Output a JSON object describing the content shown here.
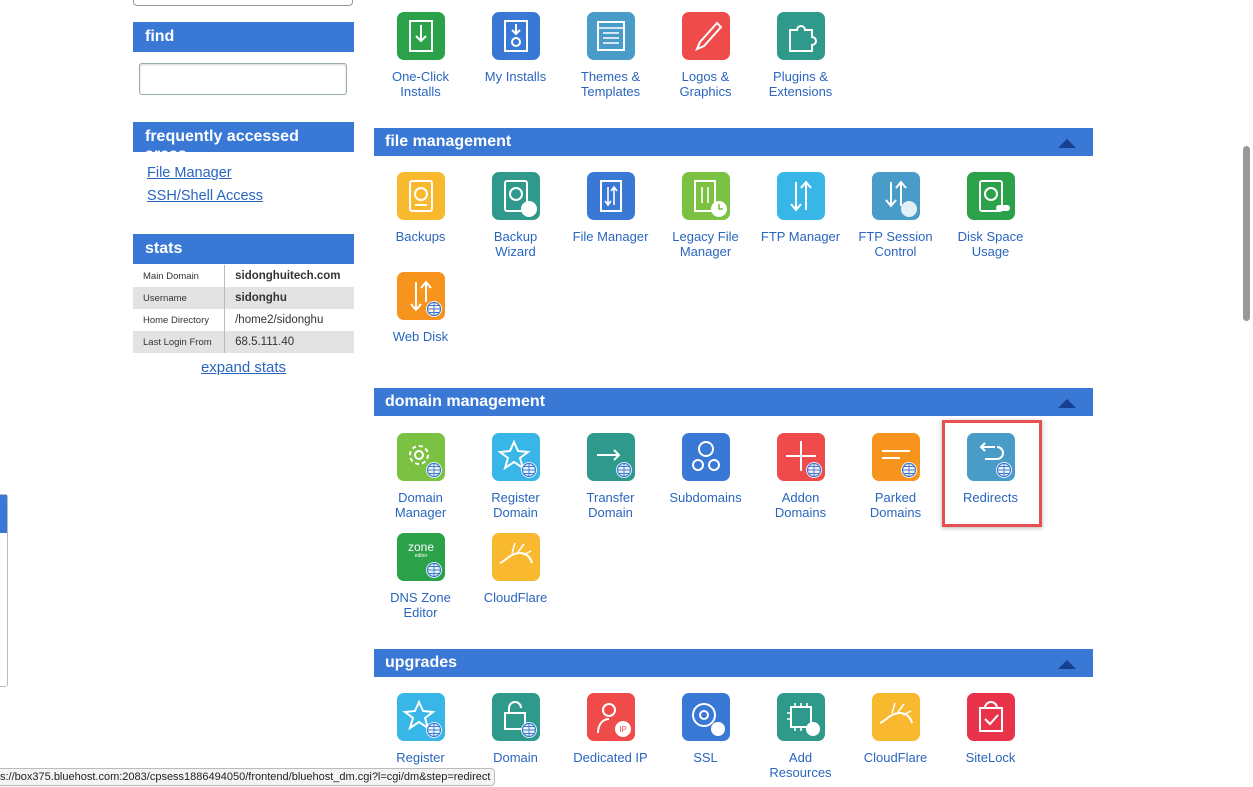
{
  "sidebar": {
    "find": {
      "title": "find",
      "value": ""
    },
    "frequent": {
      "title": "frequently accessed areas",
      "links": [
        "File Manager",
        "SSH/Shell Access"
      ]
    },
    "stats": {
      "title": "stats",
      "rows": [
        {
          "label": "Main Domain",
          "value": "sidonghuitech.com"
        },
        {
          "label": "Username",
          "value": "sidonghu"
        },
        {
          "label": "Home Directory",
          "value": "/home2/sidonghu"
        },
        {
          "label": "Last Login From",
          "value": "68.5.111.40"
        }
      ],
      "expand": "expand stats"
    }
  },
  "sections": {
    "top": {
      "items": [
        {
          "label": "One-Click\nInstalls",
          "color": "#2ba14a",
          "icon": "one-click-installs-icon"
        },
        {
          "label": "My Installs",
          "color": "#3a78d6",
          "icon": "my-installs-icon"
        },
        {
          "label": "Themes &\nTemplates",
          "color": "#4a9cc8",
          "icon": "themes-icon"
        },
        {
          "label": "Logos &\nGraphics",
          "color": "#ef4b4b",
          "icon": "paintbrush-icon"
        },
        {
          "label": "Plugins &\nExtensions",
          "color": "#2f9a8c",
          "icon": "puzzle-icon"
        }
      ]
    },
    "file": {
      "title": "file management",
      "items": [
        {
          "label": "Backups",
          "color": "#f9b92f",
          "icon": "backups-icon"
        },
        {
          "label": "Backup\nWizard",
          "color": "#2f9a8c",
          "icon": "backup-wizard-icon"
        },
        {
          "label": "File Manager",
          "color": "#3a78d6",
          "icon": "file-manager-icon"
        },
        {
          "label": "Legacy File\nManager",
          "color": "#7cc242",
          "icon": "legacy-file-manager-icon"
        },
        {
          "label": "FTP Manager",
          "color": "#39b6e8",
          "icon": "ftp-manager-icon"
        },
        {
          "label": "FTP Session\nControl",
          "color": "#4a9cc8",
          "icon": "ftp-session-icon"
        },
        {
          "label": "Disk Space\nUsage",
          "color": "#2ba14a",
          "icon": "disk-space-icon"
        },
        {
          "label": "Web Disk",
          "color": "#f7941d",
          "icon": "web-disk-icon"
        }
      ]
    },
    "domain": {
      "title": "domain management",
      "items": [
        {
          "label": "Domain\nManager",
          "color": "#7cc242",
          "icon": "domain-manager-icon"
        },
        {
          "label": "Register\nDomain",
          "color": "#39b6e8",
          "icon": "register-domain-icon"
        },
        {
          "label": "Transfer\nDomain",
          "color": "#2f9a8c",
          "icon": "transfer-domain-icon"
        },
        {
          "label": "Subdomains",
          "color": "#3a78d6",
          "icon": "subdomains-icon"
        },
        {
          "label": "Addon\nDomains",
          "color": "#ef4b4b",
          "icon": "addon-domains-icon"
        },
        {
          "label": "Parked\nDomains",
          "color": "#f7941d",
          "icon": "parked-domains-icon"
        },
        {
          "label": "Redirects",
          "color": "#4a9cc8",
          "icon": "redirects-icon"
        },
        {
          "label": "DNS Zone\nEditor",
          "color": "#2ba14a",
          "icon": "dns-zone-editor-icon",
          "badge": "zone"
        },
        {
          "label": "CloudFlare",
          "color": "#f9b92f",
          "icon": "cloudflare-icon"
        }
      ]
    },
    "upgrades": {
      "title": "upgrades",
      "items": [
        {
          "label": "Register",
          "color": "#39b6e8",
          "icon": "register-icon"
        },
        {
          "label": "Domain",
          "color": "#2f9a8c",
          "icon": "domain-privacy-icon"
        },
        {
          "label": "Dedicated IP",
          "color": "#ef4b4b",
          "icon": "dedicated-ip-icon"
        },
        {
          "label": "SSL",
          "color": "#3a78d6",
          "icon": "ssl-icon"
        },
        {
          "label": "Add\nResources",
          "color": "#2f9a8c",
          "icon": "add-resources-icon"
        },
        {
          "label": "CloudFlare",
          "color": "#f9b92f",
          "icon": "cloudflare-upgrade-icon"
        },
        {
          "label": "SiteLock",
          "color": "#e8334a",
          "icon": "sitelock-icon"
        }
      ]
    }
  },
  "status_url": "s://box375.bluehost.com:2083/cpsess1886494050/frontend/bluehost_dm.cgi?l=cgi/dm&step=redirect"
}
